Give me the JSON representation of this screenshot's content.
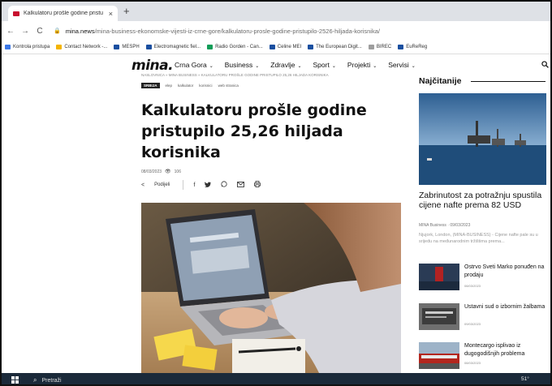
{
  "browser": {
    "tab_title": "Kalkulatoru prošle godine pristu",
    "tab_close": "×",
    "new_tab": "+",
    "url_host": "mina.news",
    "url_path": "/mina-business-ekonomske-vijesti-iz-crne-gore/kalkulatoru-prosle-godine-pristupilo-2526-hiljada-korisnika/",
    "bookmarks": [
      {
        "label": "Kontrola pristupa",
        "color": "#3b78e7"
      },
      {
        "label": "Contact Network -...",
        "color": "#f4b400"
      },
      {
        "label": "MESPH",
        "color": "#1a4fa0"
      },
      {
        "label": "Electromagnetic fiel...",
        "color": "#1a4fa0"
      },
      {
        "label": "Radio Gorden - Can...",
        "color": "#0f9d58"
      },
      {
        "label": "Celine MEI",
        "color": "#1a4fa0"
      },
      {
        "label": "The European Digit...",
        "color": "#1a4fa0"
      },
      {
        "label": "BIREC",
        "color": "#9e9e9e"
      },
      {
        "label": "EuReReg",
        "color": "#1a4fa0"
      }
    ]
  },
  "site": {
    "logo": "mina.",
    "menu": [
      "Crna Gora",
      "Business",
      "Zdravlje",
      "Sport",
      "Projekti",
      "Servisi"
    ],
    "menu_chevron": "⌄"
  },
  "article": {
    "breadcrumb": "NASLOVNICA » MINA BUSINESS » KALKULATORU PROŠLE GODINE PRISTUPILO 25,26 HILJADA KORISNIKA",
    "tag_main": "SRBIJA",
    "tags": [
      "elep",
      "kalkulator",
      "korisnici",
      "web stranica"
    ],
    "title": "Kalkulatoru prošle godine pristupilo 25,26 hiljada korisnika",
    "date": "08/03/2023",
    "views": "106",
    "share_label": "Podijeli"
  },
  "sidebar": {
    "heading": "Najčitanije",
    "lead_title": "Zabrinutost za potražnju spustila cijene nafte prema 82 USD",
    "lead_byline": "MINA Business · 09/03/2023",
    "lead_excerpt": "Njujork, London, (MINA-BUSINESS) - Cijene nafte pale su u srijedu na međunarodnim tržištima prema...",
    "items": [
      {
        "title": "Ostrvo Sveti Marko ponuđen na prodaju",
        "date": "08/03/2023"
      },
      {
        "title": "Ustavni sud o izbornim žalbama",
        "date": "09/03/2023"
      },
      {
        "title": "Montecargo isplivao iz dugogodišnjih problema",
        "date": "08/03/2023"
      }
    ]
  },
  "taskbar": {
    "search_placeholder": "Pretraži",
    "tray_text": "51°"
  }
}
